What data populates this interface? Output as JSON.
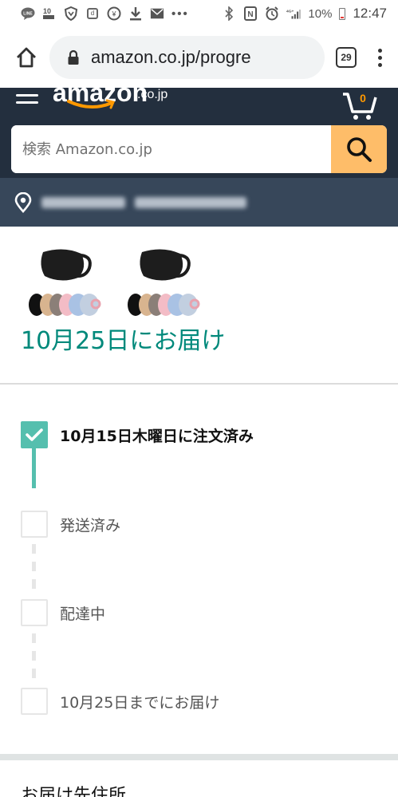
{
  "status_bar": {
    "left_icons": [
      "line-icon",
      "notification-10-icon",
      "shield-icon",
      "d-icon",
      "yen-icon",
      "download-icon",
      "mail-icon"
    ],
    "more": "•••",
    "battery_percent": "10%",
    "time": "12:47"
  },
  "browser": {
    "url": "amazon.co.jp/progre",
    "tab_count": "29"
  },
  "amazon": {
    "logo": "amazon",
    "logo_tld": ".co.jp",
    "search_placeholder": "検索 Amazon.co.jp"
  },
  "order": {
    "delivery_title": "10月25日にお届け",
    "steps": [
      {
        "label": "10月15日木曜日に注文済み",
        "done": true
      },
      {
        "label": "発送済み",
        "done": false
      },
      {
        "label": "配達中",
        "done": false
      },
      {
        "label": "10月25日までにお届け",
        "done": false
      }
    ]
  },
  "address_section": {
    "title": "お届け先住所"
  },
  "colors": {
    "accent_teal": "#00897b",
    "progress_teal": "#55bfae",
    "amazon_dark": "#232f3e",
    "amazon_location": "#37475a",
    "search_button": "#febd69"
  }
}
